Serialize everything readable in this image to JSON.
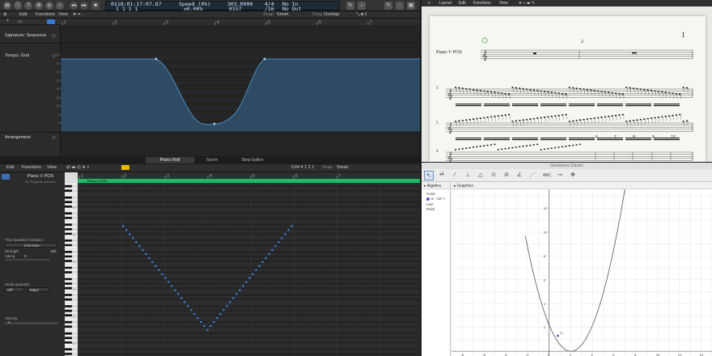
{
  "logic": {
    "transport": {
      "position_top": "0118:01:17:07.87",
      "position_bottom": "1  1  1     1",
      "tempo_label": "Speed (0%)",
      "tempo_value": "±0.00%",
      "bpm": "0157",
      "signature": "4/4",
      "division": "/16",
      "in_label": "No In",
      "out_label": "No Out",
      "tempo_field": "303.0000"
    },
    "main_menu": {
      "edit": "Edit",
      "functions": "Functions",
      "view": "View",
      "snap_label": "Snap",
      "snap_value": "Smart",
      "drag_label": "Drag",
      "drag_value": "Overlap"
    },
    "tracks": [
      {
        "name": "Signature: Sequence"
      },
      {
        "name": "Tempo: Grid"
      },
      {
        "name": "Arrangement"
      }
    ],
    "ruler_numbers": [
      "1",
      "2",
      "3",
      "4",
      "5",
      "6",
      "7"
    ],
    "tempo_scale": [
      "300",
      "270",
      "240",
      "210",
      "180",
      "150",
      "120",
      "90",
      "60"
    ],
    "editor_tabs": {
      "piano_roll": "Piano Roll",
      "score": "Score",
      "step_editor": "Step Editor"
    },
    "piano_roll": {
      "menu": {
        "edit": "Edit",
        "functions": "Functions",
        "view": "View",
        "position": "C#4  4 1 2 1",
        "snap_label": "Snap",
        "snap_value": "Smart"
      },
      "region_name": "Piano V POS",
      "region_sub": "No Regions selected",
      "region_bar_label": "Piano V POS",
      "ruler_numbers": [
        "1",
        "2",
        "3",
        "4",
        "5",
        "6",
        "7"
      ],
      "octave_labels": [
        "C6",
        "C5",
        "C4",
        "C3",
        "C2",
        "C1"
      ],
      "inspector": {
        "time_quantize_label": "Time Quantize (classic)",
        "time_quantize_value": "1/16 Note",
        "strength_label": "Strength",
        "strength_value": "100",
        "swing_label": "Swing",
        "swing_value": "0",
        "scale_quantize_label": "Scale Quantize",
        "scale_off": "Off",
        "scale_major": "Major",
        "velocity_label": "Velocity",
        "velocity_value": "0"
      },
      "note_curve": {
        "start_beat": 1.0,
        "end_beat": 3.4,
        "top_level": 0.25,
        "bottom_level": 0.85
      }
    }
  },
  "score": {
    "menu": {
      "layout": "Layout",
      "edit": "Edit",
      "functions": "Functions",
      "view": "View"
    },
    "page_number": "1",
    "instrument": "Piano V POS",
    "measure_numbers": [
      "2",
      "3",
      "4",
      "5",
      "6",
      "7",
      "8",
      "9",
      "10"
    ],
    "system_labels": [
      "3",
      "5",
      "4"
    ]
  },
  "geogebra": {
    "window_title": "GeoGebra Classic",
    "algebra_header": "Algebra",
    "graphics_header": "Graphics",
    "algebra_items": [
      "Conic",
      "a: −2x² +",
      "Line",
      "Point"
    ],
    "x_ticks": [
      "-8",
      "-6",
      "-4",
      "-2",
      "0",
      "2",
      "4",
      "6",
      "8",
      "10",
      "12",
      "14"
    ],
    "y_ticks": [
      "12",
      "10",
      "8",
      "6",
      "4",
      "2"
    ],
    "point_label": "A",
    "tool_icons": [
      "move-icon",
      "point-icon",
      "line-icon",
      "perpendicular-icon",
      "polygon-icon",
      "circle-icon",
      "ellipse-icon",
      "angle-icon",
      "reflect-icon",
      "text-icon",
      "slider-icon",
      "move-graphics-icon"
    ],
    "text_tool_label": "ABC",
    "colors": {
      "curve": "#555555",
      "point": "#6c4cc9",
      "grid": "#e6e6e6"
    }
  },
  "colors": {
    "logic_bg": "#262626",
    "tempo_fill": "#2f4a62",
    "tempo_line": "#4c8ec4",
    "region_green": "#1fb866",
    "note_blue": "#3d7fe0"
  }
}
